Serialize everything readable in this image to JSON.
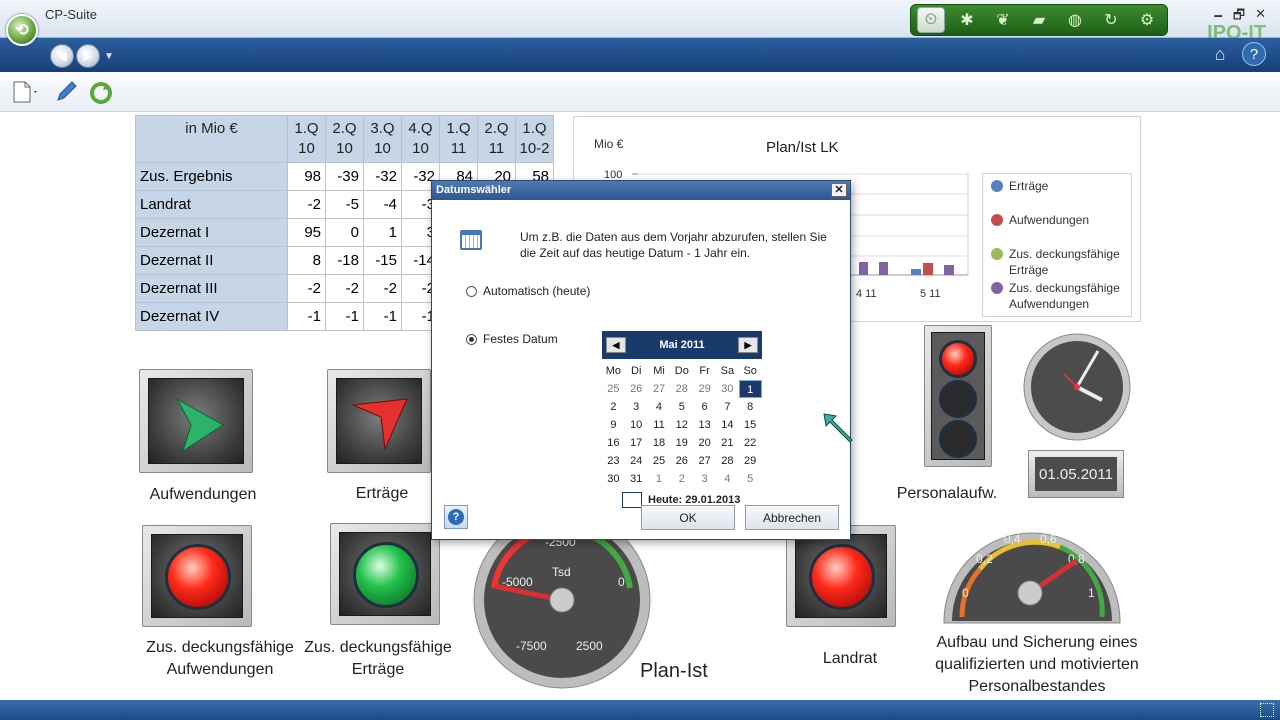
{
  "app": {
    "title": "CP-Suite",
    "brand": "IPO-IT"
  },
  "window": {
    "minimize": "🗕",
    "restore": "🗗",
    "close": "✕"
  },
  "table": {
    "header": {
      "unit": "in Mio €",
      "cols": [
        "1.Q 10",
        "2.Q 10",
        "3.Q 10",
        "4.Q 10",
        "1.Q 11",
        "2.Q 11",
        "1.Q 10-2"
      ]
    },
    "rows": [
      {
        "label": "Zus. Ergebnis",
        "values": [
          "98",
          "-39",
          "-32",
          "-32",
          "84",
          "20",
          "58"
        ]
      },
      {
        "label": "Landrat",
        "values": [
          "-2",
          "-5",
          "-4",
          "-3",
          "",
          "",
          ""
        ]
      },
      {
        "label": "Dezernat I",
        "values": [
          "95",
          "0",
          "1",
          "3",
          "",
          "",
          ""
        ]
      },
      {
        "label": "Dezernat II",
        "values": [
          "8",
          "-18",
          "-15",
          "-14",
          "",
          "",
          ""
        ]
      },
      {
        "label": "Dezernat III",
        "values": [
          "-2",
          "-2",
          "-2",
          "-2",
          "",
          "",
          ""
        ]
      },
      {
        "label": "Dezernat IV",
        "values": [
          "-1",
          "-1",
          "-1",
          "-1",
          "",
          "",
          ""
        ]
      }
    ]
  },
  "chart_data": {
    "type": "bar",
    "title": "Plan/Ist LK",
    "unit": "Mio €",
    "ytick_top": "100",
    "categories": [
      "4 11",
      "5 11"
    ],
    "series": [
      {
        "name": "Erträge",
        "color": "#5a7fc0"
      },
      {
        "name": "Aufwendungen",
        "color": "#c0504d"
      },
      {
        "name": "Zus. deckungsfähige Erträge",
        "color": "#9bbb59"
      },
      {
        "name": "Zus. deckungsfähige Aufwendungen",
        "color": "#8064a2"
      }
    ]
  },
  "tiles": {
    "aufwendungen": "Aufwendungen",
    "ertraege": "Erträge",
    "zda": "Zus. deckungsfähige Aufwendungen",
    "zde": "Zus. deckungsfähige Erträge",
    "plan_ist": "Plan-Ist",
    "landrat": "Landrat",
    "personalaufw": "Personalaufw.",
    "personal_goal": "Aufbau und Sicherung eines qualifizierten und motivierten Personalbestandes",
    "date_display": "01.05.2011"
  },
  "gauge_plan": {
    "label": "Tsd",
    "ticks": [
      "-2500",
      "-5000",
      "0",
      "-7500",
      "2500"
    ]
  },
  "gauge_personal": {
    "ticks": [
      "0,4",
      "0,6",
      "0,2",
      "0,8",
      "0",
      "1"
    ]
  },
  "dialog": {
    "title": "Datumswähler",
    "close": "✕",
    "info": "Um z.B. die Daten aus dem Vorjahr abzurufen, stellen Sie die Zeit auf das heutige Datum - 1 Jahr ein.",
    "radio_auto": "Automatisch (heute)",
    "radio_fixed": "Festes Datum",
    "month": "Mai 2011",
    "prev": "◀",
    "next": "▶",
    "dow": [
      "Mo",
      "Di",
      "Mi",
      "Do",
      "Fr",
      "Sa",
      "So"
    ],
    "days": [
      "25",
      "26",
      "27",
      "28",
      "29",
      "30",
      "1",
      "2",
      "3",
      "4",
      "5",
      "6",
      "7",
      "8",
      "9",
      "10",
      "11",
      "12",
      "13",
      "14",
      "15",
      "16",
      "17",
      "18",
      "19",
      "20",
      "21",
      "22",
      "23",
      "24",
      "25",
      "26",
      "27",
      "28",
      "29",
      "30",
      "31",
      "1",
      "2",
      "3",
      "4",
      "5"
    ],
    "today": "Heute: 29.01.2013",
    "ok": "OK",
    "cancel": "Abbrechen",
    "help": "?"
  }
}
